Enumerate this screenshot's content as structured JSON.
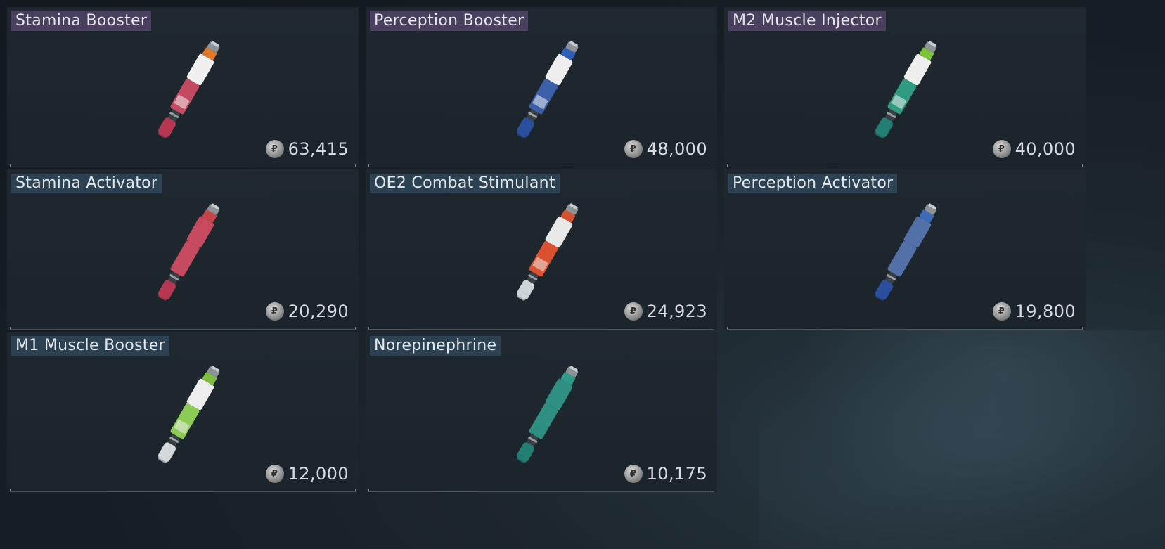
{
  "items": [
    {
      "name": "Stamina Booster",
      "price": "63,415",
      "label_style": "purple",
      "cap": "#e07a2a",
      "body": "#c44a63",
      "label": "#f0f0f0",
      "tip": "#b53752"
    },
    {
      "name": "Perception Booster",
      "price": "48,000",
      "label_style": "purple",
      "cap": "#2f5fb8",
      "body": "#3b5fa8",
      "label": "#eeeeee",
      "tip": "#2b4f9f"
    },
    {
      "name": "M2 Muscle Injector",
      "price": "40,000",
      "label_style": "purple",
      "cap": "#7cc23a",
      "body": "#2f9b80",
      "label": "#eeeeee",
      "tip": "#237f74"
    },
    {
      "name": "Stamina Activator",
      "price": "20,290",
      "label_style": "teal",
      "cap": "#c8424a",
      "body": "#c64b60",
      "label": "#c64b60",
      "tip": "#b53752"
    },
    {
      "name": "OE2 Combat Stimulant",
      "price": "24,923",
      "label_style": "teal",
      "cap": "#d6512e",
      "body": "#dc5230",
      "label": "#e8e8e8",
      "tip": "#cfd3d6"
    },
    {
      "name": "Perception Activator",
      "price": "19,800",
      "label_style": "teal",
      "cap": "#3d6bb8",
      "body": "#5470a8",
      "label": "#5470a8",
      "tip": "#2b4f9f"
    },
    {
      "name": "M1 Muscle Booster",
      "price": "12,000",
      "label_style": "teal",
      "cap": "#7dbf3c",
      "body": "#8ccc55",
      "label": "#eeeeee",
      "tip": "#d4d8da"
    },
    {
      "name": "Norepinephrine",
      "price": "10,175",
      "label_style": "teal",
      "cap": "#2f9a88",
      "body": "#2e8f82",
      "label": "#2e8f82",
      "tip": "#237f74"
    }
  ],
  "coin_icon": "rouble-coin-icon"
}
